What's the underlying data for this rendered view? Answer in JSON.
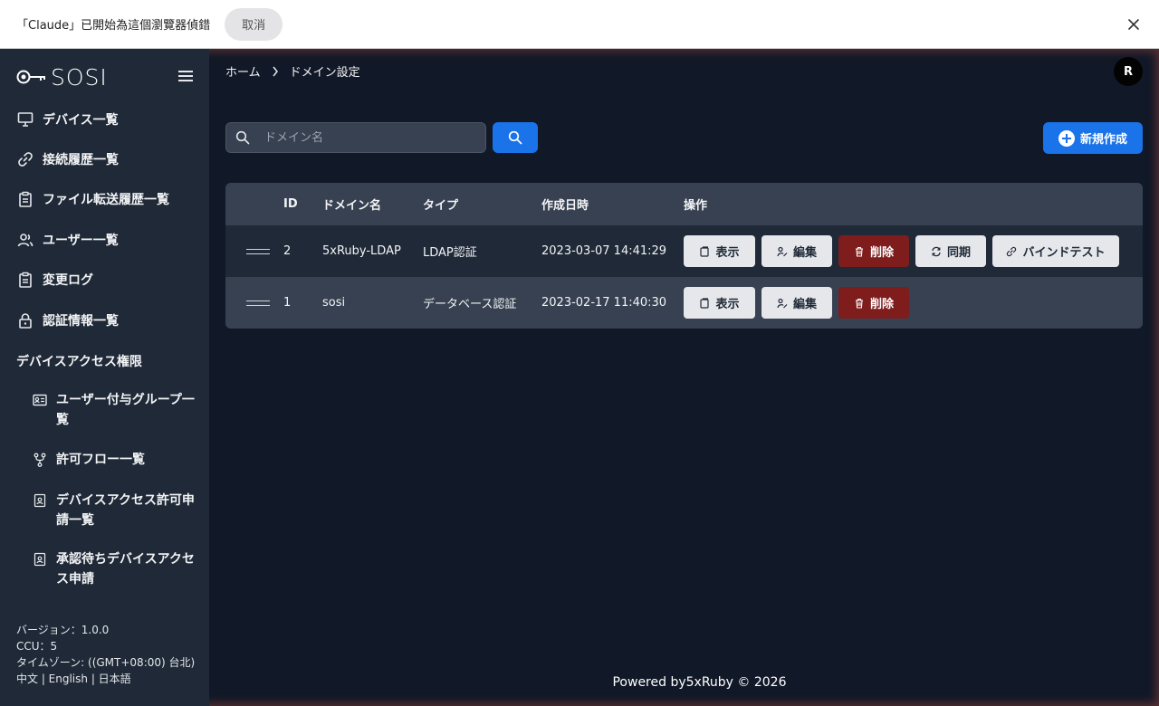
{
  "banner": {
    "text": "「Claude」已開始為這個瀏覽器偵錯",
    "cancel_label": "取消"
  },
  "sidebar": {
    "logo_text": "SOSI",
    "items": [
      {
        "label": "デバイス一覧",
        "icon": "monitor-icon"
      },
      {
        "label": "接続履歴一覧",
        "icon": "link-icon"
      },
      {
        "label": "ファイル転送履歴一覧",
        "icon": "clipboard-icon"
      },
      {
        "label": "ユーザー一覧",
        "icon": "users-icon"
      },
      {
        "label": "変更ログ",
        "icon": "clipboard-icon"
      },
      {
        "label": "認証情報一覧",
        "icon": "lock-icon"
      }
    ],
    "section_title": "デバイスアクセス権限",
    "sub_items": [
      {
        "label": "ユーザー付与グループ一覧",
        "icon": "id-card-icon"
      },
      {
        "label": "許可フロー一覧",
        "icon": "git-fork-icon"
      },
      {
        "label": "デバイスアクセス許可申請一覧",
        "icon": "badge-icon"
      },
      {
        "label": "承認待ちデバイスアクセス申請",
        "icon": "badge-icon"
      }
    ],
    "footer": {
      "version": "バージョン：1.0.0",
      "ccu": "CCU：5",
      "timezone": "タイムゾーン: ((GMT+08:00) 台北)",
      "languages": "中文 | English | 日本語"
    }
  },
  "header": {
    "breadcrumb": {
      "home": "ホーム",
      "current": "ドメイン設定"
    },
    "avatar_initial": "R"
  },
  "toolbar": {
    "search_placeholder": "ドメイン名",
    "new_label": "新規作成"
  },
  "table": {
    "columns": {
      "id": "ID",
      "name": "ドメイン名",
      "type": "タイプ",
      "created": "作成日時",
      "ops": "操作"
    },
    "rows": [
      {
        "id": "2",
        "name": "5xRuby-LDAP",
        "type": "LDAP認証",
        "created": "2023-03-07 14:41:29"
      },
      {
        "id": "1",
        "name": "sosi",
        "type": "データベース認証",
        "created": "2023-02-17 11:40:30"
      }
    ],
    "actions": {
      "view": "表示",
      "edit": "編集",
      "delete": "削除",
      "sync": "同期",
      "bind_test": "バインドテスト"
    }
  },
  "footer_text": "Powered by5xRuby © 2026",
  "colors": {
    "primary": "#1a73e8",
    "danger": "#7f1d1d",
    "sidebar_bg": "#1f2937",
    "main_bg": "#111827"
  }
}
